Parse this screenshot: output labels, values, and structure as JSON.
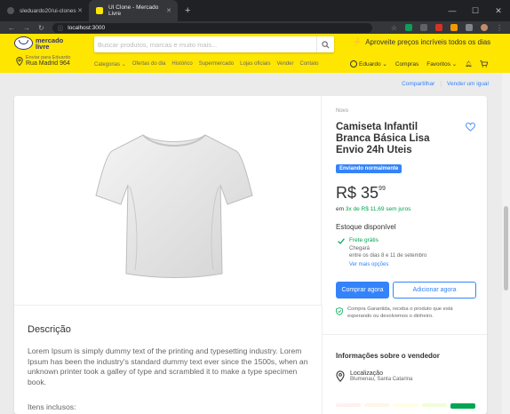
{
  "browser": {
    "tabs": [
      {
        "title": "sleduardo20/ui-clones",
        "active": false
      },
      {
        "title": "UI Clone - Mercado Livre",
        "active": true
      }
    ],
    "url": "localhost:3000"
  },
  "header": {
    "logo_line1": "mercado",
    "logo_line2": "livre",
    "search_placeholder": "Buscar produtos, marcas e muito mais...",
    "promo_text": "Aproveite preços incríveis todos os dias",
    "address_line1": "Enviar para Eduardo",
    "address_line2": "Rua Madrid 964",
    "nav": [
      "Categorias",
      "Ofertas do dia",
      "Histórico",
      "Supermercado",
      "Lojas oficiais",
      "Vender",
      "Contato"
    ],
    "user_name": "Eduardo",
    "purchases": "Compras",
    "favorites": "Favoritos"
  },
  "share": {
    "share_label": "Compartilhar",
    "sell_same": "Vender um igual"
  },
  "product": {
    "condition": "Novo",
    "title": "Camiseta Infantil Branca Básica Lisa Envio 24h Uteis",
    "badge": "Enviando normalmente",
    "price_main": "R$ 35",
    "price_cents": "99",
    "installments_prefix": "em",
    "installments_highlight": "3x de R$ 11,69 sem juros",
    "stock": "Estoque disponível",
    "shipping_free": "Frete grátis",
    "shipping_arrival": "Chegará",
    "shipping_dates": "entre os dias 8 e 11 de setembro",
    "shipping_more": "Ver mais opções",
    "buy_now": "Comprar agora",
    "add_to_cart": "Adicionar agora",
    "guarantee": "Compra Garantida, receba o produto que está esperando ou devolvemos o dinheiro."
  },
  "description": {
    "title": "Descrição",
    "text": "Lorem Ipsum is simply dummy text of the printing and typesetting industry. Lorem Ipsum has been the industry's standard dummy text ever since the 1500s, when an unknown printer took a galley of type and scrambled it to make a type specimen book.",
    "items_label": "Itens inclusos:"
  },
  "seller": {
    "title": "Informações sobre o vendedor",
    "location_label": "Localização",
    "location_value": "Blumenau, Santa Catarina"
  },
  "colors": {
    "brand_yellow": "#ffe600",
    "accent_blue": "#3483fa",
    "success_green": "#00a650"
  }
}
